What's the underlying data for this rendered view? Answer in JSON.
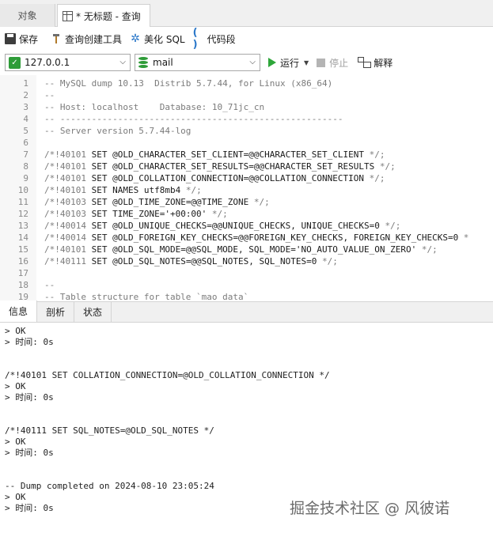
{
  "tabs": {
    "objects": "对象",
    "query": "* 无标题 - 查询"
  },
  "toolbar": {
    "save": "保存",
    "query_builder": "查询创建工具",
    "beautify_sql": "美化 SQL",
    "snippet": "代码段"
  },
  "connection": {
    "host": "127.0.0.1",
    "database": "mail",
    "run": "运行",
    "stop": "停止",
    "explain": "解释"
  },
  "editor": {
    "lines": [
      {
        "n": "1",
        "text": "-- MySQL dump 10.13  Distrib 5.7.44, for Linux (x86_64)",
        "kind": "comment"
      },
      {
        "n": "2",
        "text": "--",
        "kind": "comment"
      },
      {
        "n": "3",
        "text": "-- Host: localhost    Database: 10_71jc_cn",
        "kind": "comment"
      },
      {
        "n": "4",
        "text": "-- ------------------------------------------------------",
        "kind": "comment"
      },
      {
        "n": "5",
        "text": "-- Server version 5.7.44-log",
        "kind": "comment"
      },
      {
        "n": "6",
        "text": "",
        "kind": "comment"
      },
      {
        "n": "7",
        "text": "/*!40101 SET @OLD_CHARACTER_SET_CLIENT=@@CHARACTER_SET_CLIENT */;",
        "kind": "code"
      },
      {
        "n": "8",
        "text": "/*!40101 SET @OLD_CHARACTER_SET_RESULTS=@@CHARACTER_SET_RESULTS */;",
        "kind": "code"
      },
      {
        "n": "9",
        "text": "/*!40101 SET @OLD_COLLATION_CONNECTION=@@COLLATION_CONNECTION */;",
        "kind": "code"
      },
      {
        "n": "10",
        "text": "/*!40101 SET NAMES utf8mb4 */;",
        "kind": "code"
      },
      {
        "n": "11",
        "text": "/*!40103 SET @OLD_TIME_ZONE=@@TIME_ZONE */;",
        "kind": "code"
      },
      {
        "n": "12",
        "text": "/*!40103 SET TIME_ZONE='+00:00' */;",
        "kind": "code"
      },
      {
        "n": "13",
        "text": "/*!40014 SET @OLD_UNIQUE_CHECKS=@@UNIQUE_CHECKS, UNIQUE_CHECKS=0 */;",
        "kind": "code"
      },
      {
        "n": "14",
        "text": "/*!40014 SET @OLD_FOREIGN_KEY_CHECKS=@@FOREIGN_KEY_CHECKS, FOREIGN_KEY_CHECKS=0 *",
        "kind": "code"
      },
      {
        "n": "15",
        "text": "/*!40101 SET @OLD_SQL_MODE=@@SQL_MODE, SQL_MODE='NO_AUTO_VALUE_ON_ZERO' */;",
        "kind": "code"
      },
      {
        "n": "16",
        "text": "/*!40111 SET @OLD_SQL_NOTES=@@SQL_NOTES, SQL_NOTES=0 */;",
        "kind": "code"
      },
      {
        "n": "17",
        "text": "",
        "kind": "comment"
      },
      {
        "n": "18",
        "text": "--",
        "kind": "comment"
      },
      {
        "n": "19",
        "text": "-- Table structure for table `mao_data`",
        "kind": "comment"
      }
    ]
  },
  "bottom_tabs": {
    "info": "信息",
    "profile": "剖析",
    "status": "状态"
  },
  "output": {
    "lines": [
      "> OK",
      "> 时间: 0s",
      "",
      "",
      "/*!40101 SET COLLATION_CONNECTION=@OLD_COLLATION_CONNECTION */",
      "> OK",
      "> 时间: 0s",
      "",
      "",
      "/*!40111 SET SQL_NOTES=@OLD_SQL_NOTES */",
      "> OK",
      "> 时间: 0s",
      "",
      "",
      "-- Dump completed on 2024-08-10 23:05:24",
      "> OK",
      "> 时间: 0s"
    ]
  },
  "watermark": "掘金技术社区 @ 风彼诺",
  "colors": {
    "accent_green": "#2e9c38",
    "accent_blue": "#2a77c9",
    "comment_gray": "#7b7b7b"
  }
}
